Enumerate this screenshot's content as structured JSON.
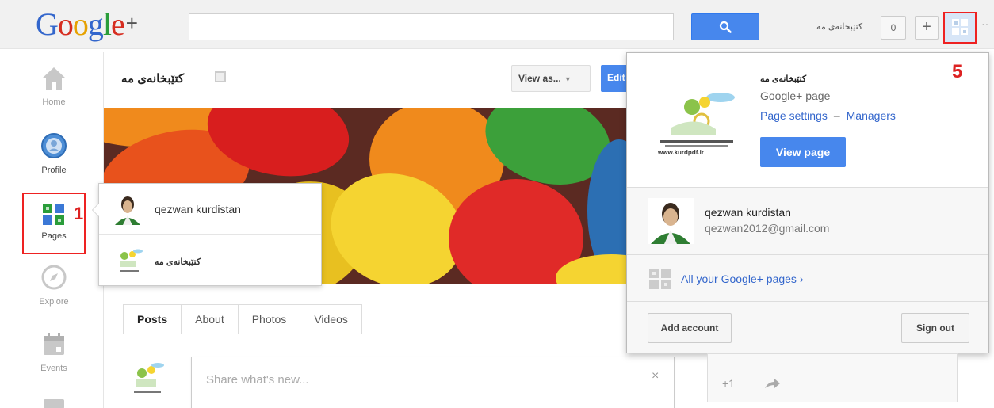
{
  "topbar": {
    "logo": {
      "G": "G",
      "o1": "o",
      "o2": "o",
      "g": "g",
      "l": "l",
      "e": "e",
      "plus": "+"
    },
    "page_name": "کتێبخانەی مە",
    "notification_count": "0",
    "share_plus": "+",
    "more": "··"
  },
  "leftnav": {
    "items": [
      {
        "label": "Home",
        "icon": "home-icon"
      },
      {
        "label": "Profile",
        "icon": "profile-icon"
      },
      {
        "label": "Pages",
        "icon": "pages-icon",
        "annotation": "1"
      },
      {
        "label": "Explore",
        "icon": "compass-icon"
      },
      {
        "label": "Events",
        "icon": "calendar-icon"
      }
    ]
  },
  "main": {
    "page_title": "کتێبخانەی مە",
    "view_as": "View as...",
    "edit_label": "Edit",
    "tabs": [
      "Posts",
      "About",
      "Photos",
      "Videos"
    ],
    "share_placeholder": "Share what's new...",
    "share_close": "×"
  },
  "flyout": {
    "items": [
      {
        "title": "qezwan kurdistan"
      },
      {
        "title": "کتێبخانەی مە"
      }
    ]
  },
  "dropdown": {
    "annotation": "5",
    "page_name": "کتێبخانەی مە",
    "page_type": "Google+ page",
    "page_settings": "Page settings",
    "link_separator": "–",
    "managers": "Managers",
    "view_page": "View page",
    "logo_caption": "www.kurdpdf.ir",
    "user_name": "qezwan kurdistan",
    "user_email": "qezwan2012@gmail.com",
    "all_pages": "All your Google+ pages ›",
    "add_account": "Add account",
    "sign_out": "Sign out"
  },
  "widget": {
    "plus_one": "+1"
  },
  "colors": {
    "blue_button": "#4787ed",
    "link": "#3366cc",
    "annotation_red": "#dd2222"
  }
}
